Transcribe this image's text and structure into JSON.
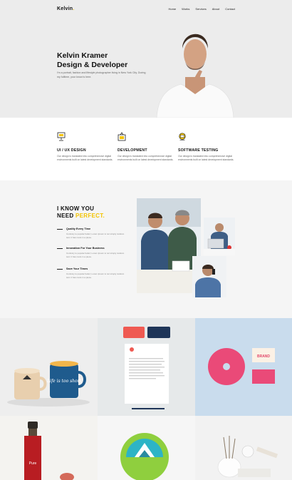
{
  "header": {
    "logo": "Kelvin",
    "logo_dot": ".",
    "nav": [
      "Home",
      "Works",
      "Services",
      "About",
      "Contact"
    ]
  },
  "hero": {
    "title_line1": "Kelvin Kramer",
    "title_line2": "Design & Developer",
    "text": "I'm a portrait, fashion and lifestyle photographer living in New York City. During my fulltime, your know is here."
  },
  "services": [
    {
      "icon": "ux-design-icon",
      "title": "UI / UX DESIGN",
      "text": "Our design is translated into comprehensive digital environments built on latest development standards."
    },
    {
      "icon": "development-icon",
      "title": "DEVELOPMENT",
      "text": "Our design is translated into comprehensive digital environments built on latest development standards."
    },
    {
      "icon": "testing-icon",
      "title": "SOFTWARE TESTING",
      "text": "Our design is translated into comprehensive digital environments built on latest development standards."
    }
  ],
  "know": {
    "title_line1": "I KNOW YOU",
    "title_line2_prefix": "NEED",
    "title_line2_accent": "PERFECT.",
    "features": [
      {
        "title": "Quality Every Time",
        "text": "Contrary to popular belief, Lorem Ipsum is not simply random text. It has roots in a piece."
      },
      {
        "title": "Innovation For Your Business",
        "text": "Contrary to popular belief, Lorem Ipsum is not simply random text. It has roots in a piece."
      },
      {
        "title": "Save Your Times",
        "text": "Contrary to popular belief, Lorem Ipsum is not simply random text. It has roots in a piece."
      }
    ]
  },
  "portfolio": {
    "mug_text": "Life is too short",
    "bottle_text": "Pure",
    "brand_text": "BRAND"
  },
  "colors": {
    "accent": "#f4c400",
    "hero_bg": "#ececec",
    "section_bg": "#f5f5f5"
  }
}
